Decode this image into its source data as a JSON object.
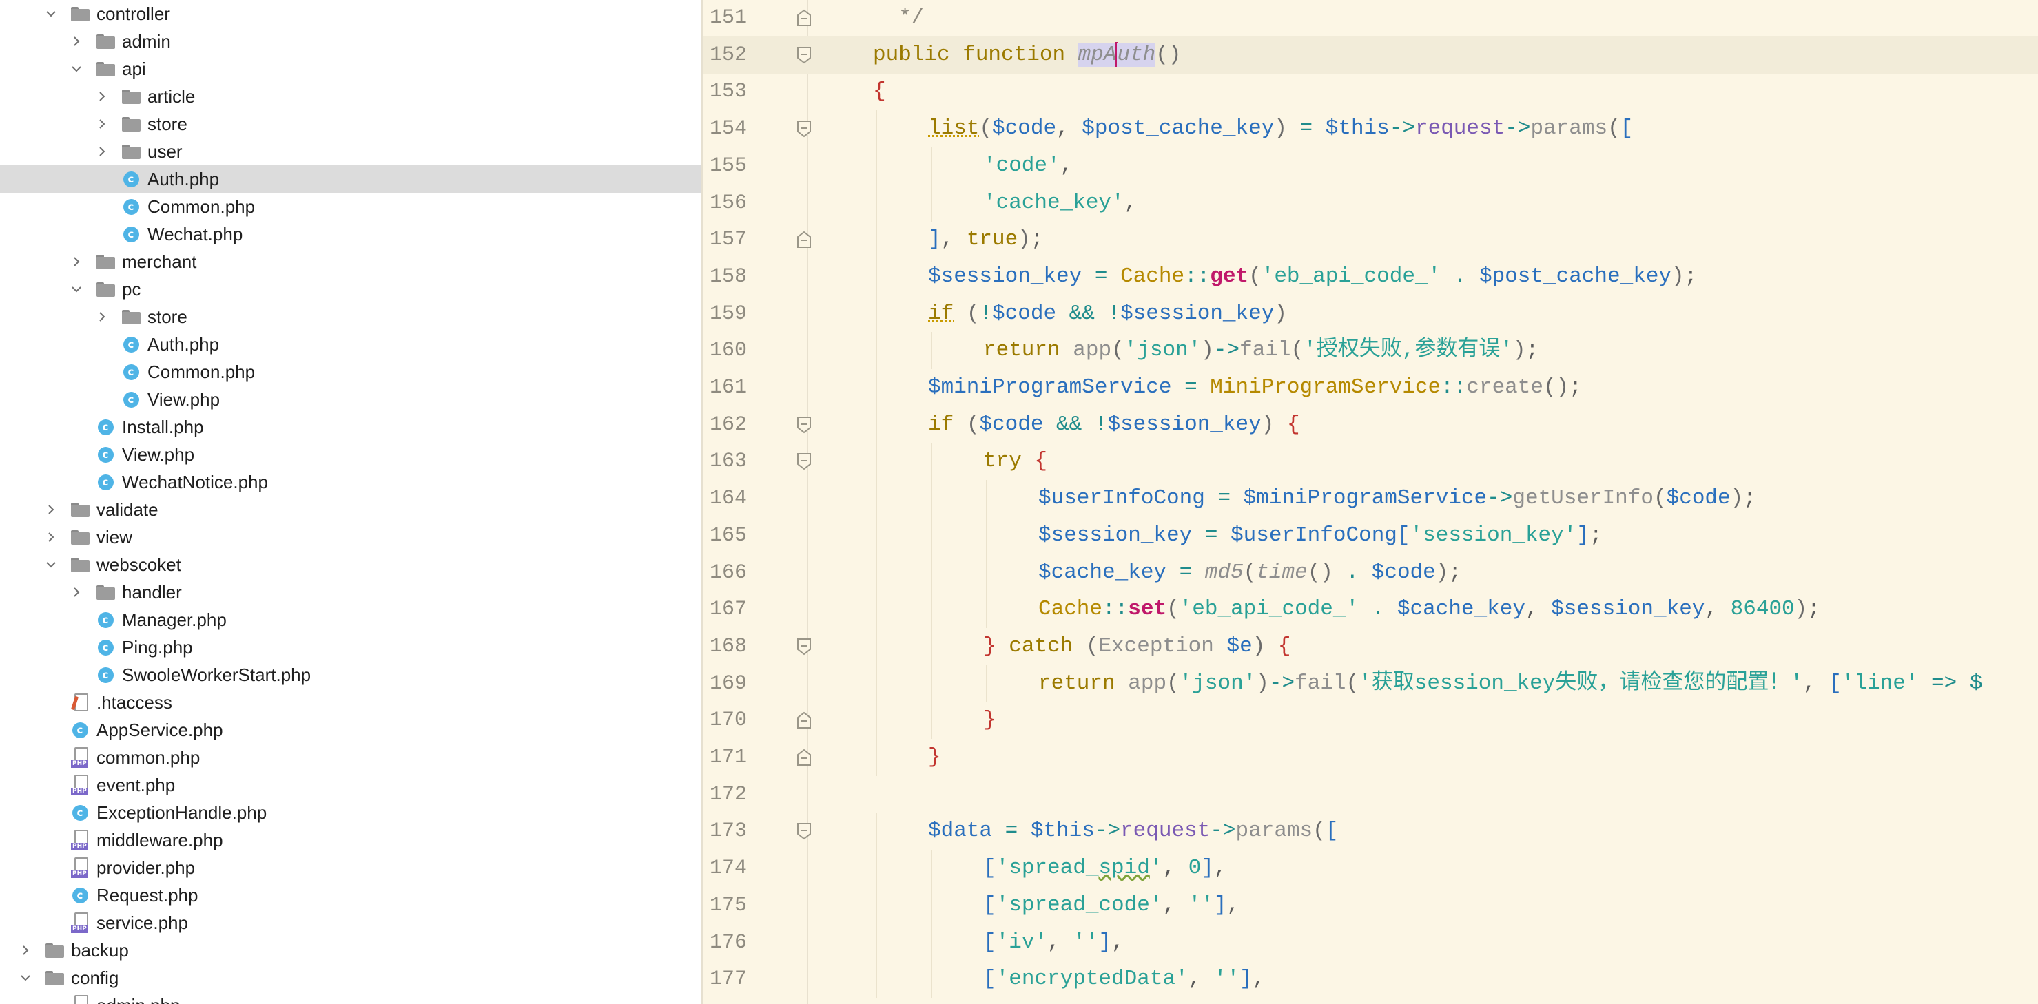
{
  "tree": {
    "items": [
      {
        "label": "controller",
        "type": "folder",
        "expanded": true,
        "depth": 2
      },
      {
        "label": "admin",
        "type": "folder",
        "expanded": false,
        "depth": 3
      },
      {
        "label": "api",
        "type": "folder",
        "expanded": true,
        "depth": 3
      },
      {
        "label": "article",
        "type": "folder",
        "expanded": false,
        "depth": 4
      },
      {
        "label": "store",
        "type": "folder",
        "expanded": false,
        "depth": 4
      },
      {
        "label": "user",
        "type": "folder",
        "expanded": false,
        "depth": 4
      },
      {
        "label": "Auth.php",
        "type": "class",
        "depth": 4,
        "selected": true
      },
      {
        "label": "Common.php",
        "type": "class",
        "depth": 4
      },
      {
        "label": "Wechat.php",
        "type": "class",
        "depth": 4
      },
      {
        "label": "merchant",
        "type": "folder",
        "expanded": false,
        "depth": 3
      },
      {
        "label": "pc",
        "type": "folder",
        "expanded": true,
        "depth": 3
      },
      {
        "label": "store",
        "type": "folder",
        "expanded": false,
        "depth": 4
      },
      {
        "label": "Auth.php",
        "type": "class",
        "depth": 4
      },
      {
        "label": "Common.php",
        "type": "class",
        "depth": 4
      },
      {
        "label": "View.php",
        "type": "class",
        "depth": 4
      },
      {
        "label": "Install.php",
        "type": "class",
        "depth": 3
      },
      {
        "label": "View.php",
        "type": "class",
        "depth": 3
      },
      {
        "label": "WechatNotice.php",
        "type": "class",
        "depth": 3
      },
      {
        "label": "validate",
        "type": "folder",
        "expanded": false,
        "depth": 2
      },
      {
        "label": "view",
        "type": "folder",
        "expanded": false,
        "depth": 2
      },
      {
        "label": "webscoket",
        "type": "folder",
        "expanded": true,
        "depth": 2
      },
      {
        "label": "handler",
        "type": "folder",
        "expanded": false,
        "depth": 3
      },
      {
        "label": "Manager.php",
        "type": "class",
        "depth": 3
      },
      {
        "label": "Ping.php",
        "type": "class",
        "depth": 3
      },
      {
        "label": "SwooleWorkerStart.php",
        "type": "class",
        "depth": 3
      },
      {
        "label": ".htaccess",
        "type": "htaccess",
        "depth": 2
      },
      {
        "label": "AppService.php",
        "type": "class",
        "depth": 2
      },
      {
        "label": "common.php",
        "type": "php",
        "depth": 2
      },
      {
        "label": "event.php",
        "type": "php",
        "depth": 2
      },
      {
        "label": "ExceptionHandle.php",
        "type": "class",
        "depth": 2
      },
      {
        "label": "middleware.php",
        "type": "php",
        "depth": 2
      },
      {
        "label": "provider.php",
        "type": "php",
        "depth": 2
      },
      {
        "label": "Request.php",
        "type": "class",
        "depth": 2
      },
      {
        "label": "service.php",
        "type": "php",
        "depth": 2
      },
      {
        "label": "backup",
        "type": "folder",
        "expanded": false,
        "depth": 1
      },
      {
        "label": "config",
        "type": "folder",
        "expanded": true,
        "depth": 1
      },
      {
        "label": "admin.php",
        "type": "php",
        "depth": 2
      }
    ]
  },
  "editor": {
    "current_line": 152,
    "lines": [
      {
        "n": 151,
        "fold": "end",
        "indent": 0,
        "tokens": [
          [
            "k-comment",
            "  */"
          ]
        ]
      },
      {
        "n": 152,
        "fold": "start",
        "indent": 0,
        "tokens": [
          [
            "k-kw",
            "public function "
          ],
          [
            "k-fn-def",
            "mpA"
          ],
          [
            "caret",
            ""
          ],
          [
            "k-fn-def",
            "uth"
          ],
          [
            "k-paren",
            "()"
          ]
        ]
      },
      {
        "n": 153,
        "fold": "",
        "indent": 0,
        "tokens": [
          [
            "k-brace",
            "{"
          ]
        ]
      },
      {
        "n": 154,
        "fold": "start",
        "indent": 1,
        "tokens": [
          [
            "k-list",
            "list"
          ],
          [
            "k-paren",
            "("
          ],
          [
            "k-var",
            "$code"
          ],
          [
            "k-punct",
            ", "
          ],
          [
            "k-var",
            "$post_cache_key"
          ],
          [
            "k-paren",
            ") "
          ],
          [
            "k-op",
            "= "
          ],
          [
            "k-var",
            "$this"
          ],
          [
            "k-op",
            "->"
          ],
          [
            "k-method",
            "request"
          ],
          [
            "k-op",
            "->"
          ],
          [
            "k-call",
            "params"
          ],
          [
            "k-paren",
            "("
          ],
          [
            "k-var",
            "["
          ]
        ]
      },
      {
        "n": 155,
        "fold": "",
        "indent": 2,
        "tokens": [
          [
            "k-str",
            "'code'"
          ],
          [
            "k-punct",
            ","
          ]
        ]
      },
      {
        "n": 156,
        "fold": "",
        "indent": 2,
        "tokens": [
          [
            "k-str",
            "'cache_key'"
          ],
          [
            "k-punct",
            ","
          ]
        ]
      },
      {
        "n": 157,
        "fold": "end",
        "indent": 1,
        "tokens": [
          [
            "k-var",
            "]"
          ],
          [
            "k-punct",
            ", "
          ],
          [
            "k-bool",
            "true"
          ],
          [
            "k-paren",
            ")"
          ],
          [
            "k-punct",
            ";"
          ]
        ]
      },
      {
        "n": 158,
        "fold": "",
        "indent": 1,
        "tokens": [
          [
            "k-var",
            "$session_key "
          ],
          [
            "k-op",
            "= "
          ],
          [
            "k-cls",
            "Cache"
          ],
          [
            "k-op",
            "::"
          ],
          [
            "k-static",
            "get"
          ],
          [
            "k-paren",
            "("
          ],
          [
            "k-str",
            "'eb_api_code_' "
          ],
          [
            "k-op",
            ". "
          ],
          [
            "k-var",
            "$post_cache_key"
          ],
          [
            "k-paren",
            ")"
          ],
          [
            "k-punct",
            ";"
          ]
        ]
      },
      {
        "n": 159,
        "fold": "",
        "indent": 1,
        "tokens": [
          [
            "k-if",
            "if"
          ],
          [
            "k-paren",
            " ("
          ],
          [
            "k-op",
            "!"
          ],
          [
            "k-var",
            "$code "
          ],
          [
            "k-op",
            "&& !"
          ],
          [
            "k-var",
            "$session_key"
          ],
          [
            "k-paren",
            ")"
          ]
        ]
      },
      {
        "n": 160,
        "fold": "",
        "indent": 2,
        "tokens": [
          [
            "k-kw",
            "return "
          ],
          [
            "k-call",
            "app"
          ],
          [
            "k-paren",
            "("
          ],
          [
            "k-str",
            "'json'"
          ],
          [
            "k-paren",
            ")"
          ],
          [
            "k-op",
            "->"
          ],
          [
            "k-call",
            "fail"
          ],
          [
            "k-paren",
            "("
          ],
          [
            "k-str",
            "'授权失败,参数有误'"
          ],
          [
            "k-paren",
            ")"
          ],
          [
            "k-punct",
            ";"
          ]
        ]
      },
      {
        "n": 161,
        "fold": "",
        "indent": 1,
        "tokens": [
          [
            "k-var",
            "$miniProgramService "
          ],
          [
            "k-op",
            "= "
          ],
          [
            "k-cls",
            "MiniProgramService"
          ],
          [
            "k-op",
            "::"
          ],
          [
            "k-call",
            "create"
          ],
          [
            "k-paren",
            "()"
          ],
          [
            "k-punct",
            ";"
          ]
        ]
      },
      {
        "n": 162,
        "fold": "start",
        "indent": 1,
        "tokens": [
          [
            "k-kw",
            "if "
          ],
          [
            "k-paren",
            "("
          ],
          [
            "k-var",
            "$code "
          ],
          [
            "k-op",
            "&& !"
          ],
          [
            "k-var",
            "$session_key"
          ],
          [
            "k-paren",
            ") "
          ],
          [
            "k-brace",
            "{"
          ]
        ]
      },
      {
        "n": 163,
        "fold": "start",
        "indent": 2,
        "tokens": [
          [
            "k-kw",
            "try "
          ],
          [
            "k-brace",
            "{"
          ]
        ]
      },
      {
        "n": 164,
        "fold": "",
        "indent": 3,
        "tokens": [
          [
            "k-var",
            "$userInfoCong "
          ],
          [
            "k-op",
            "= "
          ],
          [
            "k-var",
            "$miniProgramService"
          ],
          [
            "k-op",
            "->"
          ],
          [
            "k-call",
            "getUserInfo"
          ],
          [
            "k-paren",
            "("
          ],
          [
            "k-var",
            "$code"
          ],
          [
            "k-paren",
            ")"
          ],
          [
            "k-punct",
            ";"
          ]
        ]
      },
      {
        "n": 165,
        "fold": "",
        "indent": 3,
        "tokens": [
          [
            "k-var",
            "$session_key "
          ],
          [
            "k-op",
            "= "
          ],
          [
            "k-var",
            "$userInfoCong["
          ],
          [
            "k-str",
            "'session_key'"
          ],
          [
            "k-var",
            "]"
          ],
          [
            "k-punct",
            ";"
          ]
        ]
      },
      {
        "n": 166,
        "fold": "",
        "indent": 3,
        "tokens": [
          [
            "k-var",
            "$cache_key "
          ],
          [
            "k-op",
            "= "
          ],
          [
            "k-ital",
            "md5"
          ],
          [
            "k-paren",
            "("
          ],
          [
            "k-ital",
            "time"
          ],
          [
            "k-paren",
            "() "
          ],
          [
            "k-op",
            ". "
          ],
          [
            "k-var",
            "$code"
          ],
          [
            "k-paren",
            ")"
          ],
          [
            "k-punct",
            ";"
          ]
        ]
      },
      {
        "n": 167,
        "fold": "",
        "indent": 3,
        "tokens": [
          [
            "k-cls",
            "Cache"
          ],
          [
            "k-op",
            "::"
          ],
          [
            "k-static",
            "set"
          ],
          [
            "k-paren",
            "("
          ],
          [
            "k-str",
            "'eb_api_code_' "
          ],
          [
            "k-op",
            ". "
          ],
          [
            "k-var",
            "$cache_key"
          ],
          [
            "k-punct",
            ", "
          ],
          [
            "k-var",
            "$session_key"
          ],
          [
            "k-punct",
            ", "
          ],
          [
            "k-num",
            "86400"
          ],
          [
            "k-paren",
            ")"
          ],
          [
            "k-punct",
            ";"
          ]
        ]
      },
      {
        "n": 168,
        "fold": "start",
        "indent": 2,
        "tokens": [
          [
            "k-brace",
            "} "
          ],
          [
            "k-kw",
            "catch "
          ],
          [
            "k-paren",
            "("
          ],
          [
            "k-call",
            "Exception "
          ],
          [
            "k-var",
            "$e"
          ],
          [
            "k-paren",
            ") "
          ],
          [
            "k-brace",
            "{"
          ]
        ]
      },
      {
        "n": 169,
        "fold": "",
        "indent": 3,
        "tokens": [
          [
            "k-kw",
            "return "
          ],
          [
            "k-call",
            "app"
          ],
          [
            "k-paren",
            "("
          ],
          [
            "k-str",
            "'json'"
          ],
          [
            "k-paren",
            ")"
          ],
          [
            "k-op",
            "->"
          ],
          [
            "k-call",
            "fail"
          ],
          [
            "k-paren",
            "("
          ],
          [
            "k-str",
            "'获取session_key失败，请检查您的配置！'"
          ],
          [
            "k-punct",
            ", "
          ],
          [
            "k-var",
            "["
          ],
          [
            "k-str",
            "'line' "
          ],
          [
            "k-op",
            "=> $"
          ]
        ]
      },
      {
        "n": 170,
        "fold": "end",
        "indent": 2,
        "tokens": [
          [
            "k-brace",
            "}"
          ]
        ]
      },
      {
        "n": 171,
        "fold": "end",
        "indent": 1,
        "tokens": [
          [
            "k-brace",
            "}"
          ]
        ]
      },
      {
        "n": 172,
        "fold": "",
        "indent": 0,
        "tokens": []
      },
      {
        "n": 173,
        "fold": "start",
        "indent": 1,
        "tokens": [
          [
            "k-var",
            "$data "
          ],
          [
            "k-op",
            "= "
          ],
          [
            "k-var",
            "$this"
          ],
          [
            "k-op",
            "->"
          ],
          [
            "k-method",
            "request"
          ],
          [
            "k-op",
            "->"
          ],
          [
            "k-call",
            "params"
          ],
          [
            "k-paren",
            "("
          ],
          [
            "k-var",
            "["
          ]
        ]
      },
      {
        "n": 174,
        "fold": "",
        "indent": 2,
        "tokens": [
          [
            "k-var",
            "["
          ],
          [
            "k-str",
            "'spread_"
          ],
          [
            "k-str k-squig",
            "spid"
          ],
          [
            "k-str",
            "'"
          ],
          [
            "k-punct",
            ", "
          ],
          [
            "k-num",
            "0"
          ],
          [
            "k-var",
            "]"
          ],
          [
            "k-punct",
            ","
          ]
        ]
      },
      {
        "n": 175,
        "fold": "",
        "indent": 2,
        "tokens": [
          [
            "k-var",
            "["
          ],
          [
            "k-str",
            "'spread_code'"
          ],
          [
            "k-punct",
            ", "
          ],
          [
            "k-str",
            "''"
          ],
          [
            "k-var",
            "]"
          ],
          [
            "k-punct",
            ","
          ]
        ]
      },
      {
        "n": 176,
        "fold": "",
        "indent": 2,
        "tokens": [
          [
            "k-var",
            "["
          ],
          [
            "k-str",
            "'iv'"
          ],
          [
            "k-punct",
            ", "
          ],
          [
            "k-str",
            "''"
          ],
          [
            "k-var",
            "]"
          ],
          [
            "k-punct",
            ","
          ]
        ]
      },
      {
        "n": 177,
        "fold": "",
        "indent": 2,
        "tokens": [
          [
            "k-var",
            "["
          ],
          [
            "k-str",
            "'encryptedData'"
          ],
          [
            "k-punct",
            ", "
          ],
          [
            "k-str",
            "''"
          ],
          [
            "k-var",
            "]"
          ],
          [
            "k-punct",
            ","
          ]
        ]
      }
    ]
  }
}
